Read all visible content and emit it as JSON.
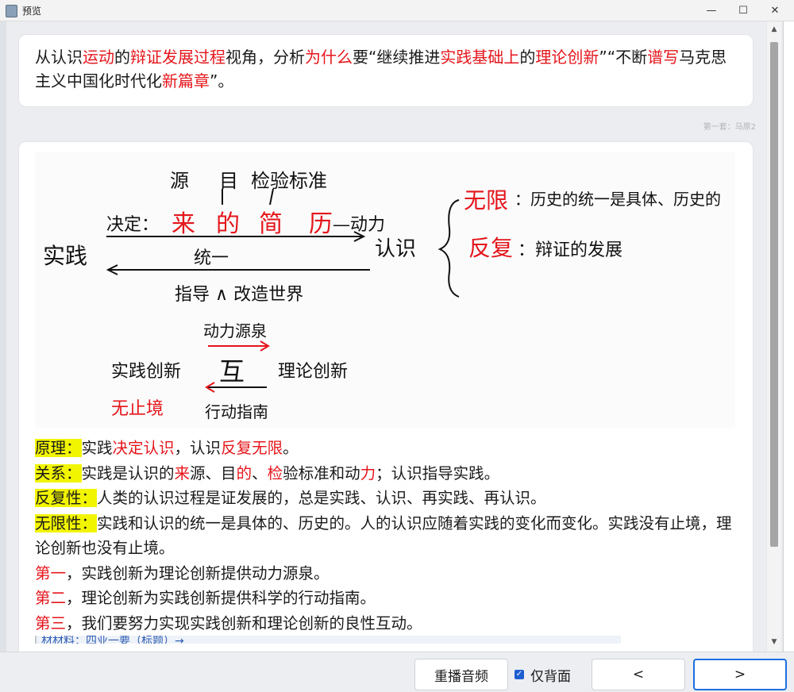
{
  "window": {
    "title": "预览",
    "min_icon": "minimize-icon",
    "max_icon": "maximize-icon",
    "close_icon": "close-icon",
    "min_glyph": "—",
    "max_glyph": "☐",
    "close_glyph": "✕"
  },
  "question": {
    "parts": [
      {
        "t": "从认识",
        "red": false
      },
      {
        "t": "运动",
        "red": true
      },
      {
        "t": "的",
        "red": false
      },
      {
        "t": "辩证发展过程",
        "red": true
      },
      {
        "t": "视角，分析",
        "red": false
      },
      {
        "t": "为什么",
        "red": true
      },
      {
        "t": "要“继续推进",
        "red": false
      },
      {
        "t": "实践基础上",
        "red": true
      },
      {
        "t": "的",
        "red": false
      },
      {
        "t": "理论创新",
        "red": true
      },
      {
        "t": "”“不断",
        "red": false
      },
      {
        "t": "谱写",
        "red": true
      },
      {
        "t": "马克思主义中国化时代化",
        "red": false
      },
      {
        "t": "新篇章",
        "red": true
      },
      {
        "t": "”。",
        "red": false
      }
    ]
  },
  "deck_label": "第一套：马原2",
  "handwritten_note": {
    "practice": "实践",
    "decide": "决定：",
    "source": "来",
    "purpose": "的",
    "test": "简",
    "force": "历",
    "force_tail": "—动力",
    "src_word": "源",
    "goal_word": "目",
    "standard": "检验标准",
    "unity": "统一",
    "guide": "指导 ∧ 改造世界",
    "cognition": "认识",
    "infinite": "无限",
    "infinite_desc": "：历史的统一是具体、历史的",
    "repeat": "反复",
    "repeat_desc": "：辩证的发展",
    "source_power": "动力源泉",
    "mutual": "互",
    "practice_innov": "实践创新",
    "theory_innov": "理论创新",
    "endless": "无止境",
    "action_guide": "行动指南"
  },
  "answer": {
    "l1": [
      {
        "t": "原理：",
        "hl": true
      },
      {
        "t": "实践",
        "red": false
      },
      {
        "t": "决定认识",
        "red": true
      },
      {
        "t": "，认识",
        "red": false
      },
      {
        "t": "反复无限",
        "red": true
      },
      {
        "t": "。",
        "red": false
      }
    ],
    "l2": [
      {
        "t": "关系：",
        "hl": true
      },
      {
        "t": "实践是认识的",
        "red": false
      },
      {
        "t": "来",
        "red": true
      },
      {
        "t": "源、目",
        "red": false
      },
      {
        "t": "的",
        "red": true
      },
      {
        "t": "、",
        "red": false
      },
      {
        "t": "检",
        "red": true
      },
      {
        "t": "验标准和动",
        "red": false
      },
      {
        "t": "力",
        "red": true
      },
      {
        "t": "；认识指导实践。",
        "red": false
      }
    ],
    "l3": [
      {
        "t": "反复性：",
        "hl": true
      },
      {
        "t": "人类的认识过程是证发展的，总是实践、认识、再实践、再认识。",
        "red": false
      }
    ],
    "l4": [
      {
        "t": "无限性：",
        "hl": true
      },
      {
        "t": "实践和认识的统一是具体的、历史的。人的认识应随着实践的变化而变化。实践没有止境，理论创新也没有止境。",
        "red": false
      }
    ],
    "l5": [
      {
        "t": "第一",
        "red": true
      },
      {
        "t": "，实践创新为理论创新提供动力源泉。",
        "red": false
      }
    ],
    "l6": [
      {
        "t": "第二",
        "red": true
      },
      {
        "t": "，理论创新为实践创新提供科学的行动指南。",
        "red": false
      }
    ],
    "l7": [
      {
        "t": "第三",
        "red": true
      },
      {
        "t": "，我们要努力实现实践创新和理论创新的良性互动。",
        "red": false
      }
    ],
    "cut_text": "材材料：四业一要（标题）→"
  },
  "controls": {
    "replay_audio": "重播音频",
    "back_only": "仅背面",
    "prev": "<",
    "next": ">",
    "check_glyph": "✓"
  },
  "colors": {
    "red": "#e4161c",
    "highlight": "#f2f500",
    "accent": "#1e6fe0"
  }
}
